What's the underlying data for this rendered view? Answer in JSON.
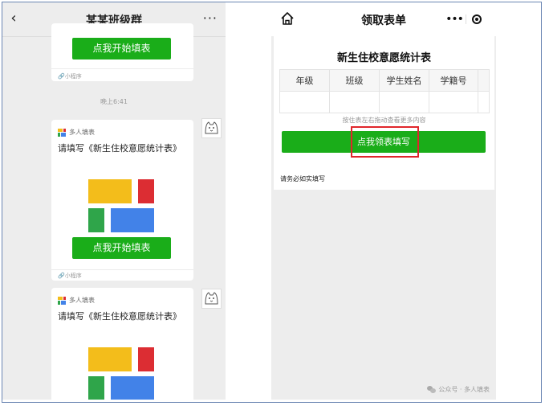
{
  "left_chat": {
    "title": "某某班级群",
    "back_icon": "‹",
    "more_icon": "···",
    "timestamp": "晚上6:41",
    "cards": [
      {
        "button_label": "点我开始填表",
        "mini_program_tag": "小程序"
      },
      {
        "app_name": "多人填表",
        "title": "请填写《新生住校意愿统计表》",
        "button_label": "点我开始填表",
        "mini_program_tag": "小程序"
      },
      {
        "app_name": "多人填表",
        "title": "请填写《新生住校意愿统计表》"
      }
    ]
  },
  "right_app": {
    "header_title": "领取表单",
    "capsule_more": "•••",
    "form_title": "新生住校意愿统计表",
    "columns": [
      "年级",
      "班级",
      "学生姓名",
      "学籍号",
      ""
    ],
    "scroll_hint": "按住表左右拖动查看更多内容",
    "claim_button": "点我领表填写",
    "notice": "请务必如实填写",
    "watermark": "公众号 · 多人填表"
  },
  "colors": {
    "primary_green": "#1aad19",
    "highlight_red": "#e0262b",
    "block_yellow": "#f3bd1b",
    "block_red": "#dc2d33",
    "block_green": "#2fa54a",
    "block_blue": "#4282e8"
  }
}
